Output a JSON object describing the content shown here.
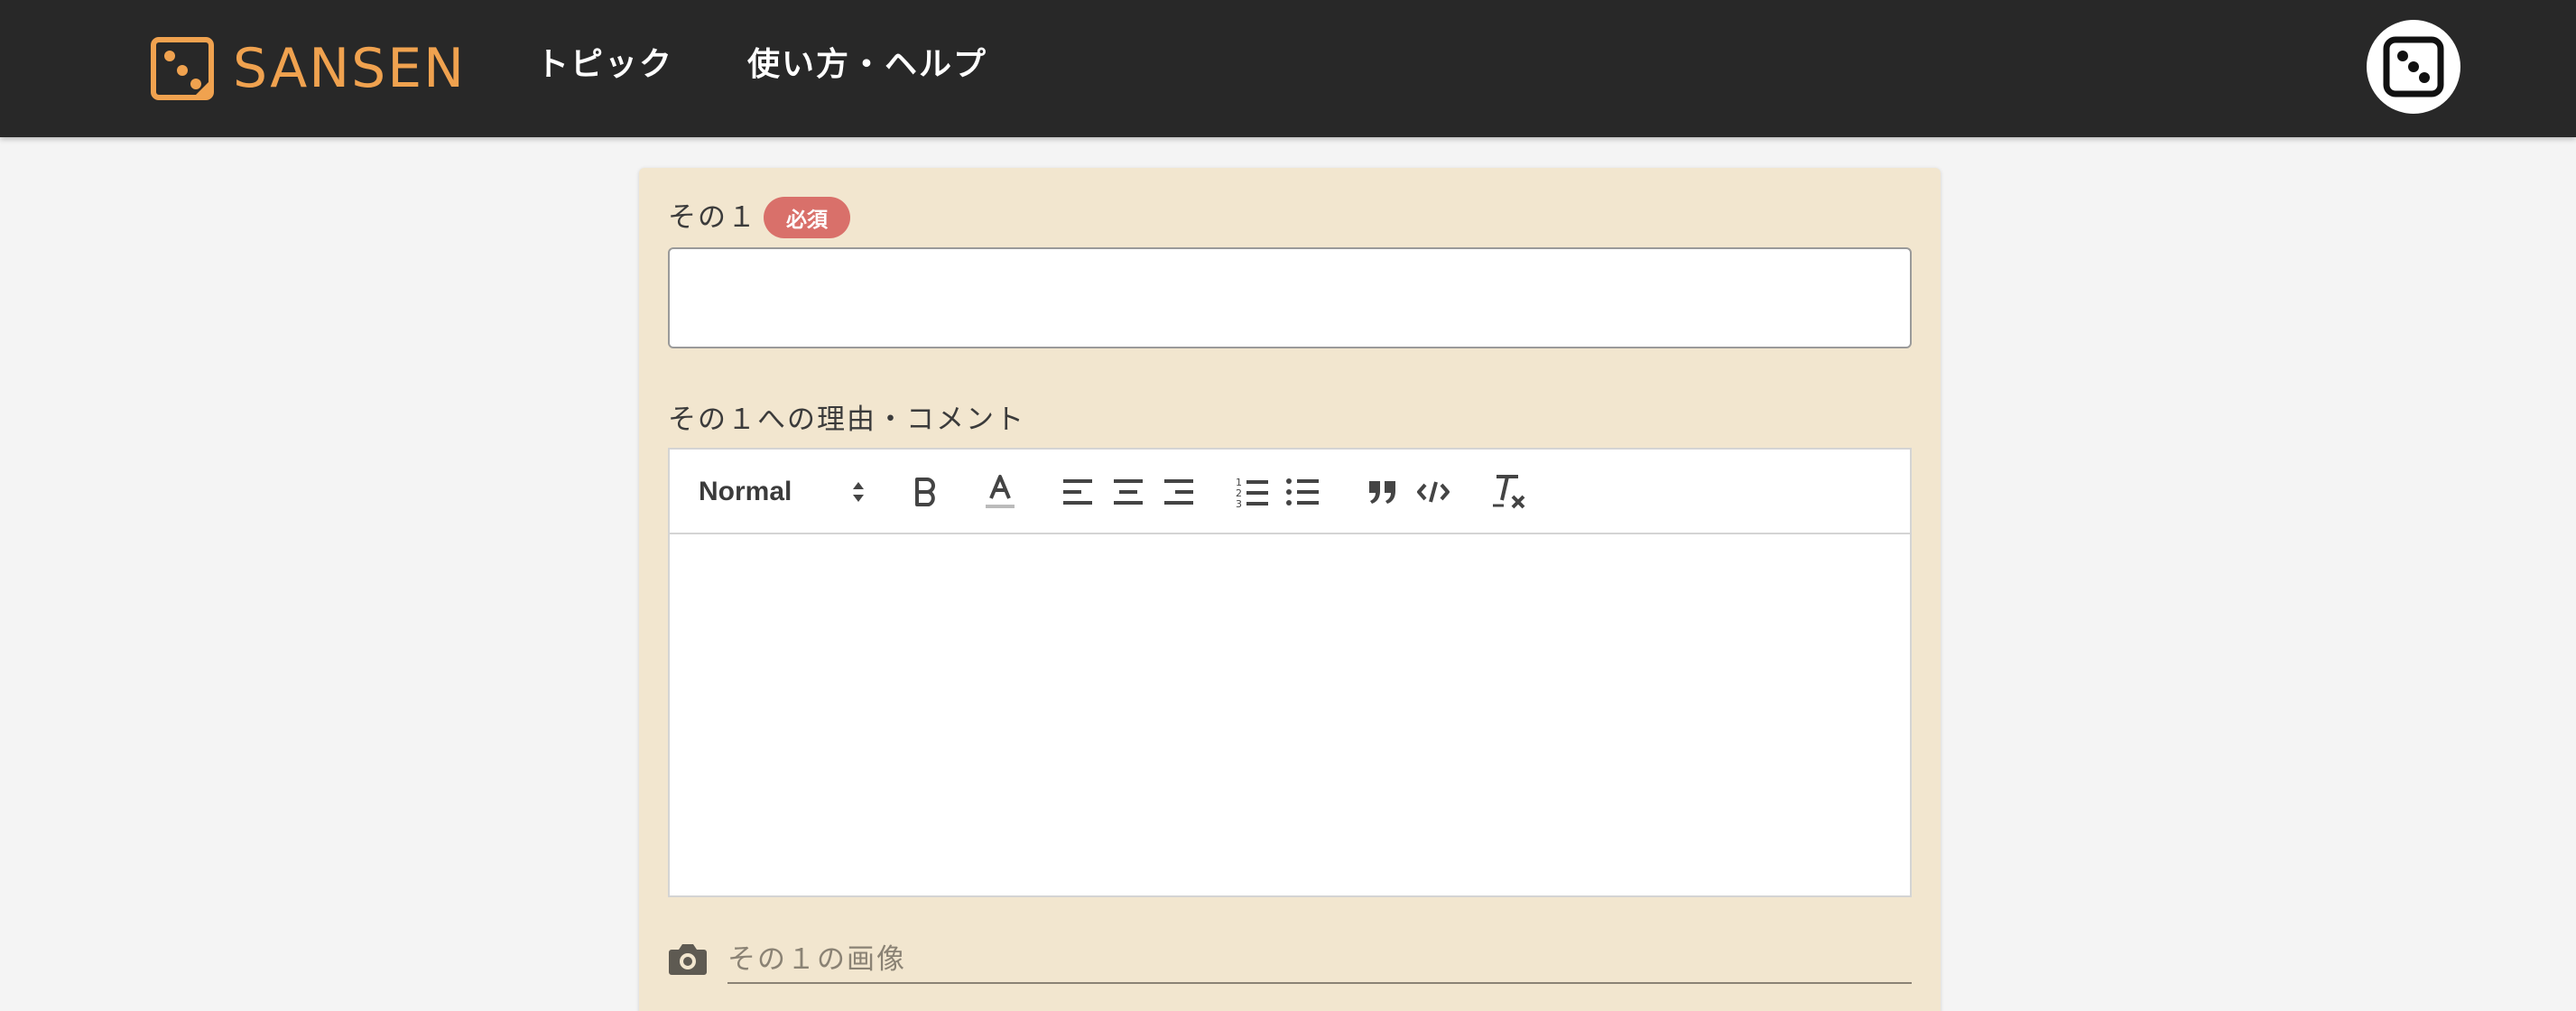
{
  "header": {
    "brand": "SANSEN",
    "nav": [
      {
        "label": "トピック"
      },
      {
        "label": "使い方・ヘルプ"
      }
    ],
    "avatar_icon": "dice-three-icon"
  },
  "form": {
    "field1": {
      "label": "その１",
      "required_badge": "必須",
      "value": ""
    },
    "field2": {
      "label": "その１への理由・コメント",
      "toolbar": {
        "header_select": "Normal",
        "buttons": [
          "bold-icon",
          "text-color-icon",
          "align-left-icon",
          "align-center-icon",
          "align-right-icon",
          "ordered-list-icon",
          "bullet-list-icon",
          "blockquote-icon",
          "code-icon",
          "clear-format-icon"
        ]
      },
      "value": ""
    },
    "image": {
      "placeholder": "その１の画像"
    }
  },
  "colors": {
    "navbar": "#282828",
    "brand": "#f0a24f",
    "card": "#f2e6cf",
    "required": "#d9706a"
  }
}
